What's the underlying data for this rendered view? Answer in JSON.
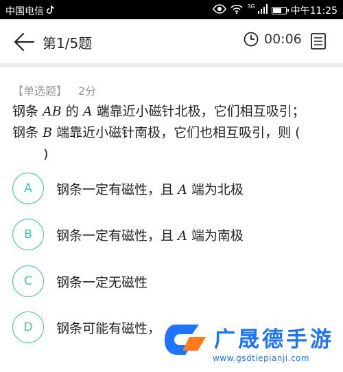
{
  "status_bar": {
    "carrier": "中国电信",
    "network": "3G",
    "time": "中午11:25"
  },
  "header": {
    "question_counter": "第1/5题",
    "timer": "00:06"
  },
  "question": {
    "type": "【单选题】",
    "score": "2分",
    "line1_a": "钢条",
    "line1_m1": "AB",
    "line1_b": "的",
    "line1_m2": "A",
    "line1_c": "端靠近小磁针北极，它们相互吸引；",
    "line2_a": "钢条",
    "line2_m1": "B",
    "line2_b": "端靠近小磁针南极，它们也相互吸引，则 (",
    "line3": ")"
  },
  "options": [
    {
      "letter": "A",
      "text_a": "钢条一定有磁性，且",
      "math": "A",
      "text_b": "端为北极"
    },
    {
      "letter": "B",
      "text_a": "钢条一定有磁性，且",
      "math": "A",
      "text_b": "端为南极"
    },
    {
      "letter": "C",
      "text_a": "钢条一定无磁性",
      "math": "",
      "text_b": ""
    },
    {
      "letter": "D",
      "text_a": "钢条可能有磁性，",
      "math": "",
      "text_b": ""
    }
  ],
  "watermark": {
    "title": "广晟德手游",
    "url": "www.gsdtiepianji.com"
  },
  "colors": {
    "accent": "#3cc6a6",
    "watermark": "#1e73ff"
  }
}
